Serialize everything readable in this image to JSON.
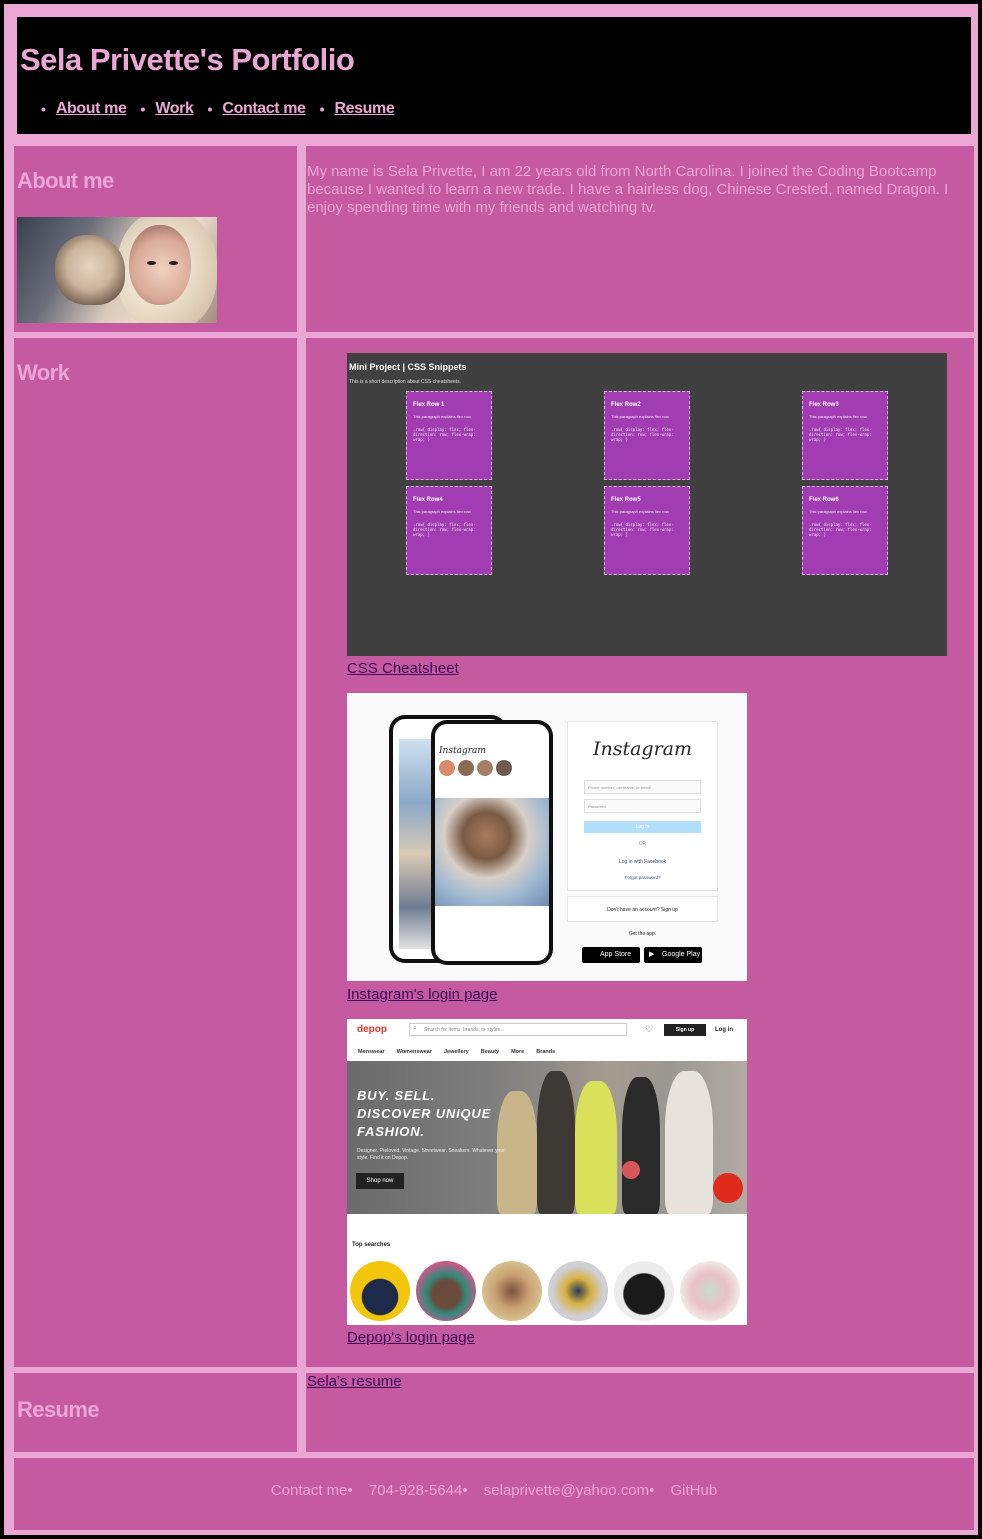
{
  "header": {
    "title": "Sela Privette's Portfolio",
    "nav": [
      {
        "label": "About me"
      },
      {
        "label": "Work"
      },
      {
        "label": "Contact me"
      },
      {
        "label": "Resume"
      }
    ]
  },
  "about": {
    "heading": "About me",
    "text": "My name is Sela Privette, I am 22 years old from North Carolina. I joined the Coding Bootcamp because I wanted to learn a new trade. I have a hairless dog, Chinese Crested, named Dragon. I enjoy spending time with my friends and watching tv."
  },
  "work": {
    "heading": "Work",
    "projects": [
      {
        "link": "CSS Cheatsheet",
        "thumb": {
          "title": "Mini Project | CSS Snippets",
          "subtitle": "This is a short description about CSS cheatsheets.",
          "cards": [
            {
              "title": "Flex Row 1",
              "desc": "This paragraph explains flex row.",
              "code": ".row{ display: flex; flex-direction: row; flex-wrap: wrap; }"
            },
            {
              "title": "Flex Row2",
              "desc": "This paragraph explains flex row.",
              "code": ".row{ display: flex; flex-direction: row; flex-wrap: wrap; }"
            },
            {
              "title": "Flex Row3",
              "desc": "This paragraph explains flex row.",
              "code": ".row{ display: flex; flex-direction: row; flex-wrap: wrap; }"
            },
            {
              "title": "Flex Row4",
              "desc": "This paragraph explains flex row.",
              "code": ".row{ display: flex; flex-direction: row; flex-wrap: wrap; }"
            },
            {
              "title": "Flex Row5",
              "desc": "This paragraph explains flex row.",
              "code": ".row{ display: flex; flex-direction: row; flex-wrap: wrap; }"
            },
            {
              "title": "Flex Row6",
              "desc": "This paragraph explains flex row.",
              "code": ".row{ display: flex; flex-direction: row; flex-wrap: wrap; }"
            }
          ]
        }
      },
      {
        "link": "Instagram's login page",
        "thumb": {
          "logo": "Instagram",
          "username_placeholder": "Phone number, username, or email",
          "password_placeholder": "Password",
          "login_button": "Log In",
          "or": "OR",
          "facebook": "Log in with Facebook",
          "forgot": "Forgot password?",
          "signup_text": "Don't have an account? Sign up",
          "get_app": "Get the app.",
          "app_store": "App Store",
          "google_play": "Google Play"
        }
      },
      {
        "link": "Depop's login page",
        "thumb": {
          "logo": "depop",
          "search_placeholder": "Search for items, brands, or styles...",
          "signup": "Sign up",
          "login": "Log in",
          "nav": [
            "Menswear",
            "Womenswear",
            "Jewellery",
            "Beauty",
            "More",
            "Brands"
          ],
          "hero_title": "BUY. SELL. DISCOVER UNIQUE FASHION.",
          "hero_sub": "Designer. Preloved. Vintage. Streetwear. Sneakers. Whatever your style. Find it on Depop.",
          "hero_button": "Shop now",
          "top_searches": "Top searches"
        }
      }
    ]
  },
  "resume": {
    "heading": "Resume",
    "link": "Sela's resume"
  },
  "footer": {
    "items": [
      "Contact me•",
      "704-928-5644•",
      "selaprivette@yahoo.com•",
      "GitHub"
    ]
  },
  "colors": {
    "background": "#eaa6d4",
    "panel": "#c65aa0",
    "header": "#000000",
    "link": "#3a0a5a"
  }
}
